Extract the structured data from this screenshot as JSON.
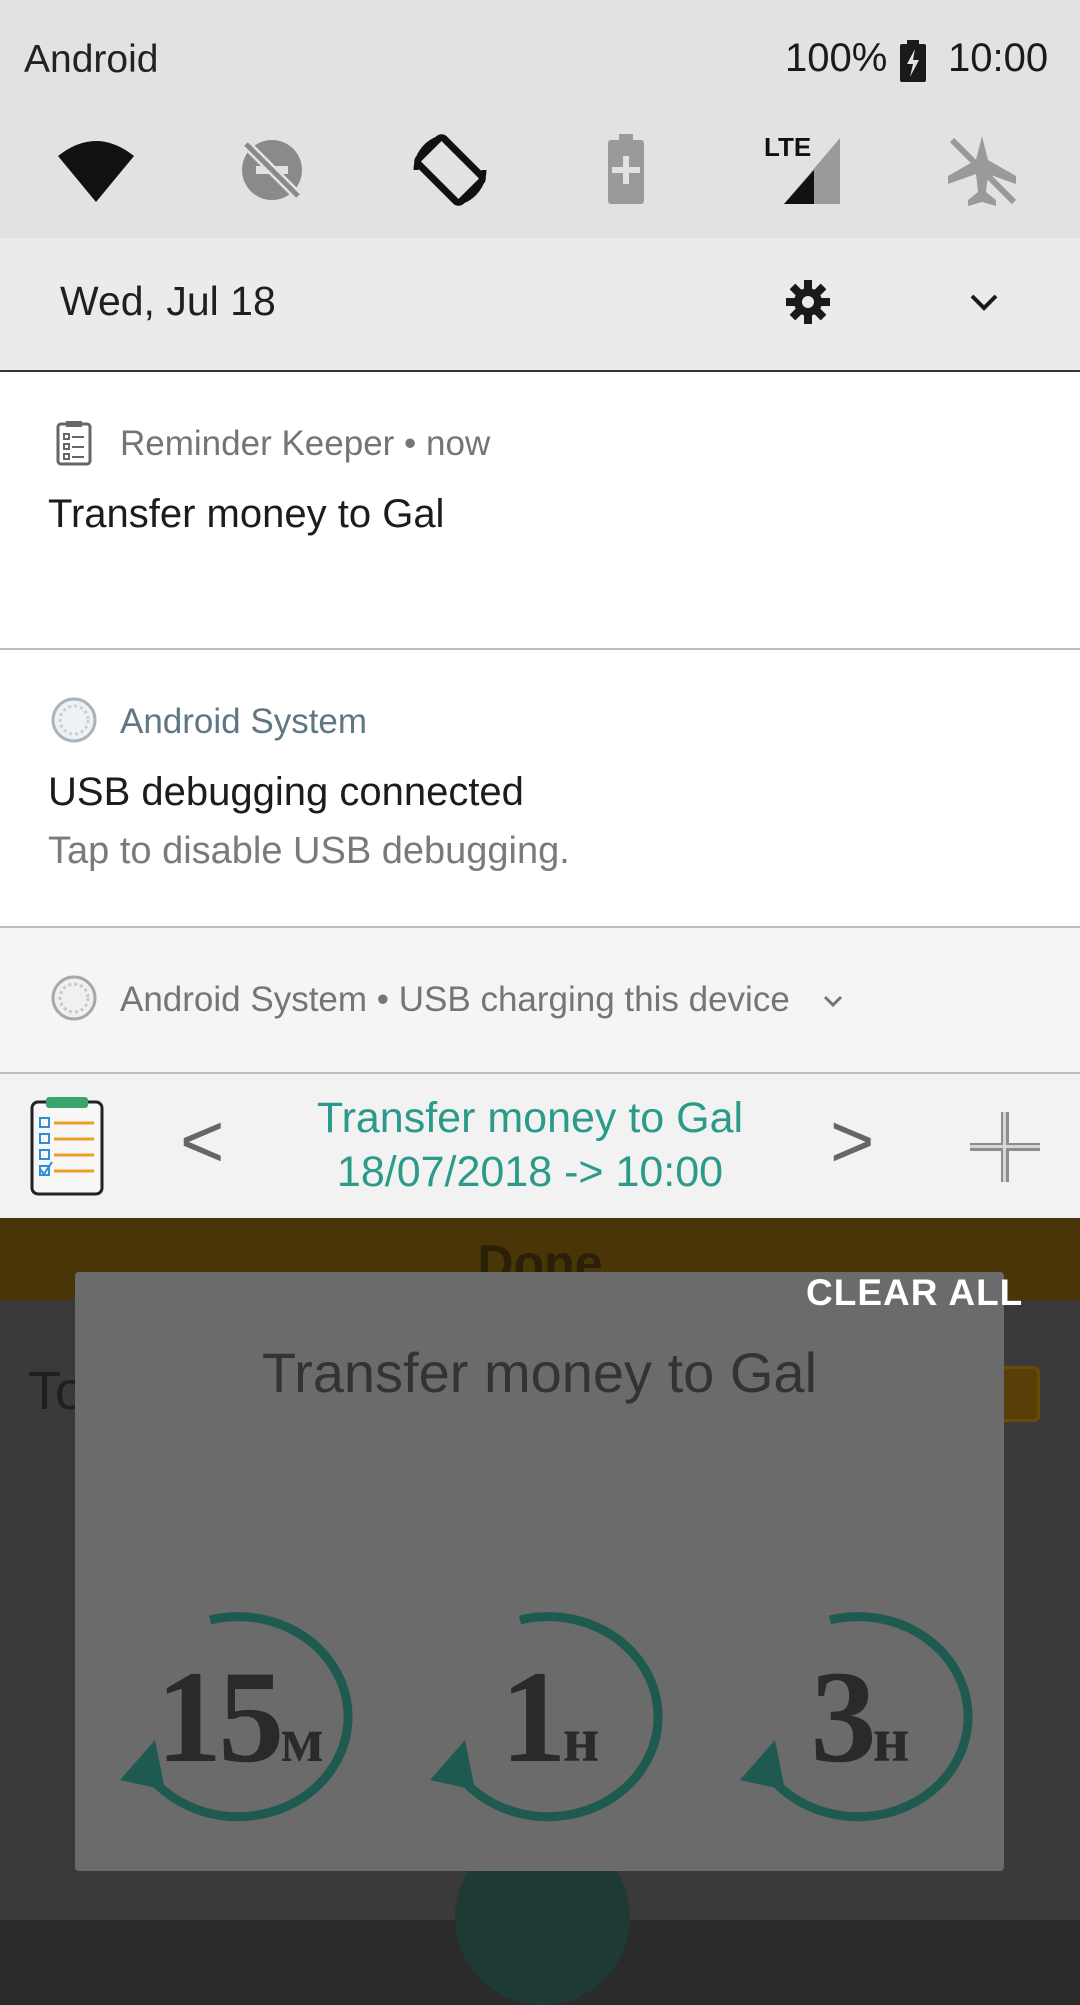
{
  "status_bar": {
    "carrier": "Android",
    "battery": "100%",
    "time": "10:00"
  },
  "quick_settings": {
    "tiles": [
      {
        "icon": "wifi-icon"
      },
      {
        "icon": "data-saver-icon"
      },
      {
        "icon": "auto-rotate-icon"
      },
      {
        "icon": "battery-saver-icon"
      },
      {
        "icon": "mobile-data-lte-icon",
        "badge": "LTE"
      },
      {
        "icon": "airplane-mode-icon"
      }
    ],
    "date": "Wed, Jul 18"
  },
  "notifications": [
    {
      "app": "Reminder Keeper",
      "time": "now",
      "title": "Transfer money to Gal"
    },
    {
      "app": "Android System",
      "title": "USB debugging connected",
      "text": "Tap to disable USB debugging."
    },
    {
      "app": "Android System",
      "summary": "USB charging this device"
    }
  ],
  "reminder_widget": {
    "prev": "<",
    "next": ">",
    "title": "Transfer money to Gal",
    "datetime": "18/07/2018 -> 10:00"
  },
  "clear_all": "CLEAR ALL",
  "background_app": {
    "done_label": "Done",
    "row_text": "To",
    "popup_title": "Transfer money to Gal",
    "snooze_options": [
      {
        "number": "15",
        "unit": "м"
      },
      {
        "number": "1",
        "unit": "н"
      },
      {
        "number": "3",
        "unit": "н"
      }
    ]
  },
  "colors": {
    "accent_teal": "#2b9a8a",
    "shade_bg": "#e2e2e2"
  }
}
